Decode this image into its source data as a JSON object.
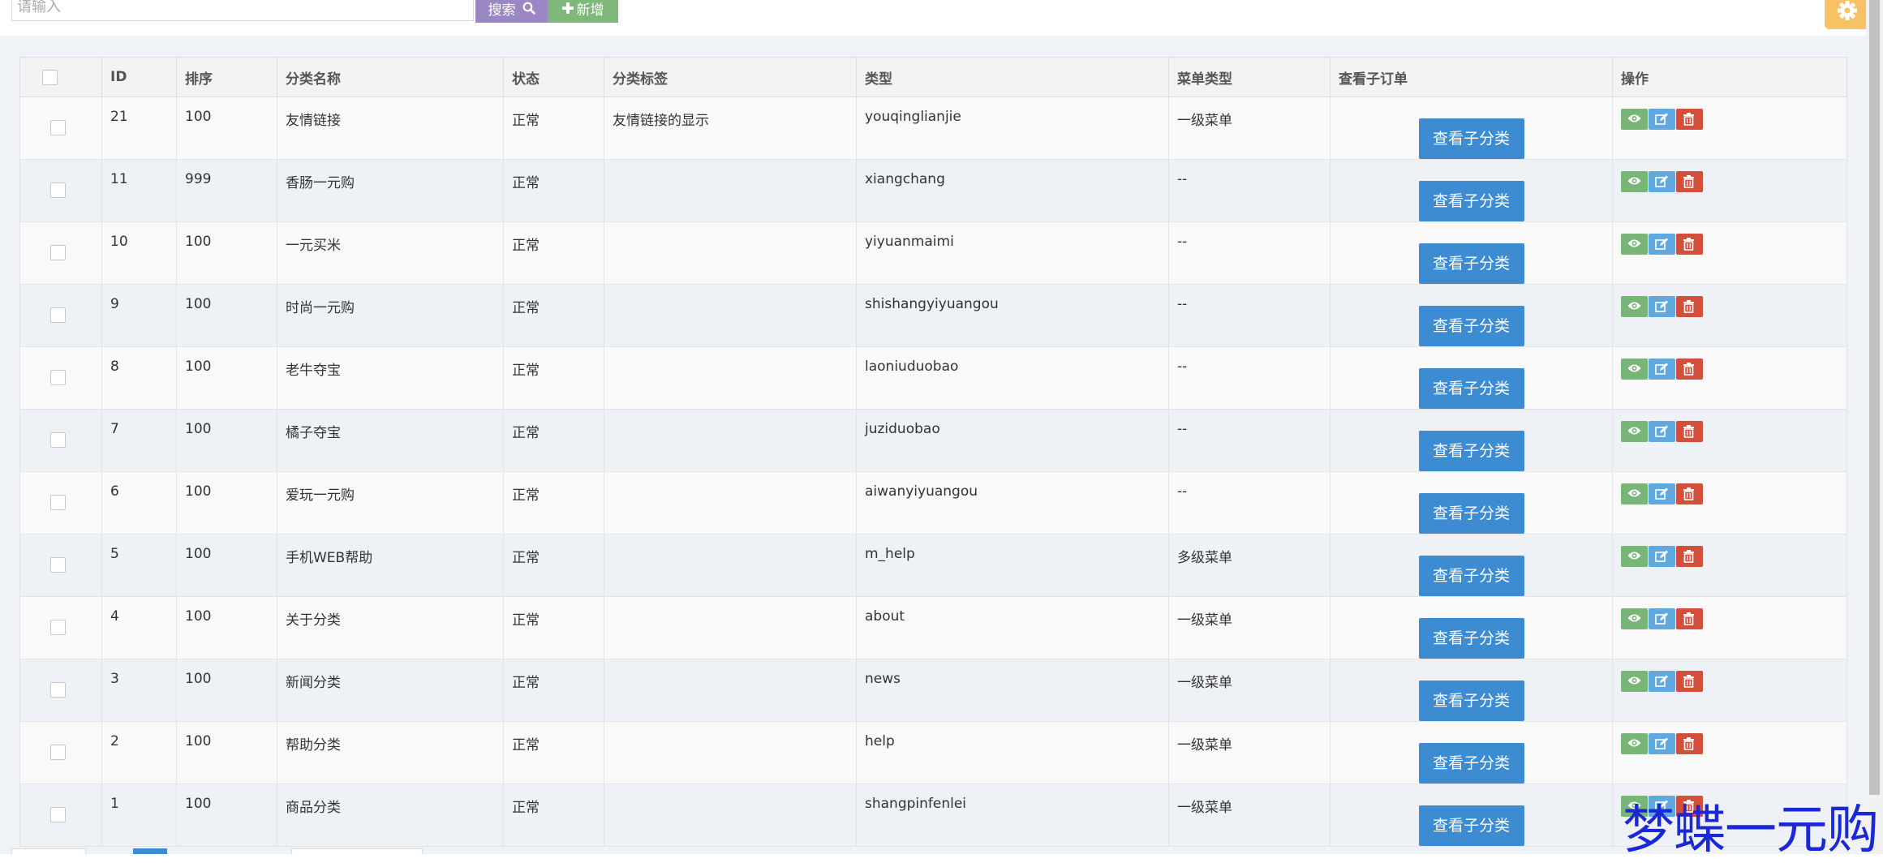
{
  "toolbar": {
    "search_placeholder": "请输入",
    "search_label": "搜索",
    "add_label": "新增"
  },
  "table": {
    "headers": {
      "id": "ID",
      "sort": "排序",
      "name": "分类名称",
      "status": "状态",
      "tag": "分类标签",
      "type": "类型",
      "menu_type": "菜单类型",
      "view_sub": "查看子订单",
      "ops": "操作"
    },
    "sub_button_label": "查看子分类",
    "rows": [
      {
        "id": "21",
        "sort": "100",
        "name": "友情链接",
        "status": "正常",
        "tag": "友情链接的显示",
        "type": "youqinglianjie",
        "menu_type": "一级菜单"
      },
      {
        "id": "11",
        "sort": "999",
        "name": "香肠一元购",
        "status": "正常",
        "tag": "",
        "type": "xiangchang",
        "menu_type": "--"
      },
      {
        "id": "10",
        "sort": "100",
        "name": "一元买米",
        "status": "正常",
        "tag": "",
        "type": "yiyuanmaimi",
        "menu_type": "--"
      },
      {
        "id": "9",
        "sort": "100",
        "name": "时尚一元购",
        "status": "正常",
        "tag": "",
        "type": "shishangyiyuangou",
        "menu_type": "--"
      },
      {
        "id": "8",
        "sort": "100",
        "name": "老牛夺宝",
        "status": "正常",
        "tag": "",
        "type": "laoniuduobao",
        "menu_type": "--"
      },
      {
        "id": "7",
        "sort": "100",
        "name": "橘子夺宝",
        "status": "正常",
        "tag": "",
        "type": "juziduobao",
        "menu_type": "--"
      },
      {
        "id": "6",
        "sort": "100",
        "name": "爱玩一元购",
        "status": "正常",
        "tag": "",
        "type": "aiwanyiyuangou",
        "menu_type": "--"
      },
      {
        "id": "5",
        "sort": "100",
        "name": "手机WEB帮助",
        "status": "正常",
        "tag": "",
        "type": "m_help",
        "menu_type": "多级菜单"
      },
      {
        "id": "4",
        "sort": "100",
        "name": "关于分类",
        "status": "正常",
        "tag": "",
        "type": "about",
        "menu_type": "一级菜单"
      },
      {
        "id": "3",
        "sort": "100",
        "name": "新闻分类",
        "status": "正常",
        "tag": "",
        "type": "news",
        "menu_type": "一级菜单"
      },
      {
        "id": "2",
        "sort": "100",
        "name": "帮助分类",
        "status": "正常",
        "tag": "",
        "type": "help",
        "menu_type": "一级菜单"
      },
      {
        "id": "1",
        "sort": "100",
        "name": "商品分类",
        "status": "正常",
        "tag": "",
        "type": "shangpinfenlei",
        "menu_type": "一级菜单"
      }
    ]
  },
  "watermark": "梦蝶一元购",
  "colors": {
    "search_button": "#9b87c3",
    "add_button": "#7fb87a",
    "sub_button": "#3d8bd0",
    "view_button": "#78b677",
    "edit_button": "#5fa9e0",
    "delete_button": "#d24f3c",
    "settings_button": "#f6c265"
  },
  "icons": {
    "search": "search-icon",
    "add": "plus-icon",
    "settings": "gear-icon",
    "view": "eye-icon",
    "edit": "edit-icon",
    "delete": "trash-icon"
  }
}
